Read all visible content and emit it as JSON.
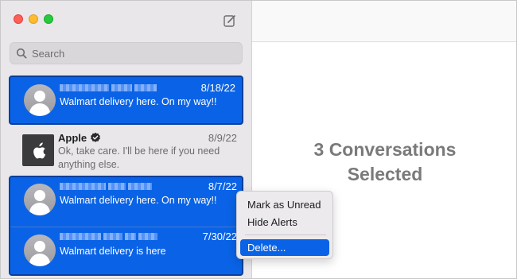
{
  "search": {
    "placeholder": "Search"
  },
  "conversations": [
    {
      "date": "8/18/22",
      "message": "Walmart delivery here. On my way!!",
      "selected": true
    },
    {
      "name": "Apple",
      "date": "8/9/22",
      "message_line1": "Ok, take care. I'll be here if you need",
      "message_line2": "anything else.",
      "selected": false,
      "verified": true
    },
    {
      "date": "8/7/22",
      "message": "Walmart delivery here. On my way!!",
      "selected": true
    },
    {
      "date": "7/30/22",
      "message": "Walmart delivery is here",
      "selected": true
    }
  ],
  "main": {
    "line1": "3 Conversations",
    "line2": "Selected"
  },
  "context_menu": {
    "items": [
      "Mark as Unread",
      "Hide Alerts",
      "Delete..."
    ],
    "highlighted": "Delete..."
  },
  "colors": {
    "selection": "#0a63e6",
    "sidebar": "#e9e7ea"
  },
  "icons": [
    "compose-icon",
    "search-icon",
    "avatar-icon",
    "apple-logo-icon",
    "verified-badge-icon"
  ]
}
